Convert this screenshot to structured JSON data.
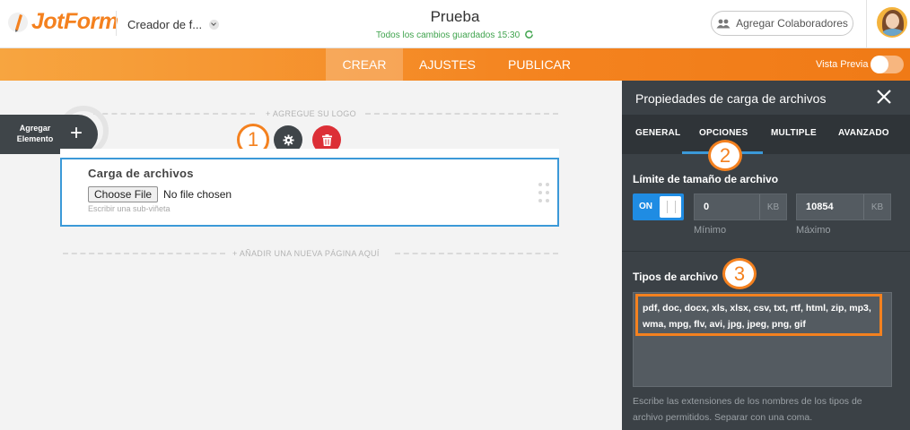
{
  "brand": {
    "name": "JotForm",
    "accent": "#f4811f"
  },
  "header": {
    "creator_label": "Creador de f...",
    "form_title": "Prueba",
    "save_status": "Todos los cambios guardados 15:30",
    "collab_button": "Agregar Colaboradores"
  },
  "nav": {
    "tabs": [
      {
        "label": "CREAR",
        "active": true
      },
      {
        "label": "AJUSTES",
        "active": false
      },
      {
        "label": "PUBLICAR",
        "active": false
      }
    ],
    "preview_label": "Vista Previa",
    "preview_enabled": false
  },
  "canvas": {
    "logo_hint": "+ AGREGUE SU LOGO",
    "add_element_label": "Agregar Elemento",
    "add_element_icon": "plus-icon",
    "new_page_hint": "+ AÑADIR UNA NUEVA PÁGINA AQUÍ",
    "annotation_1": "1",
    "field": {
      "label": "Carga de archivos",
      "choose_button": "Choose File",
      "file_status": "No file chosen",
      "sublabel": "Escribir una sub-viñeta"
    }
  },
  "panel": {
    "title": "Propiedades de carga de archivos",
    "tabs": [
      {
        "label": "GENERAL",
        "active": false
      },
      {
        "label": "OPCIONES",
        "active": true
      },
      {
        "label": "MULTIPLE",
        "active": false
      },
      {
        "label": "AVANZADO",
        "active": false
      }
    ],
    "annotation_2": "2",
    "annotation_3": "3",
    "size_limit": {
      "title": "Límite de tamaño de archivo",
      "toggle_label": "ON",
      "min_value": "0",
      "min_unit": "KB",
      "min_caption": "Mínimo",
      "max_value": "10854",
      "max_unit": "KB",
      "max_caption": "Máximo"
    },
    "file_types": {
      "title": "Tipos de archivo",
      "value": "pdf, doc, docx, xls, xlsx, csv, txt, rtf, html, zip, mp3, wma, mpg, flv, avi, jpg, jpeg, png, gif",
      "help": "Escribe las extensiones de los nombres de los tipos de archivo permitidos. Separar con una coma."
    }
  }
}
